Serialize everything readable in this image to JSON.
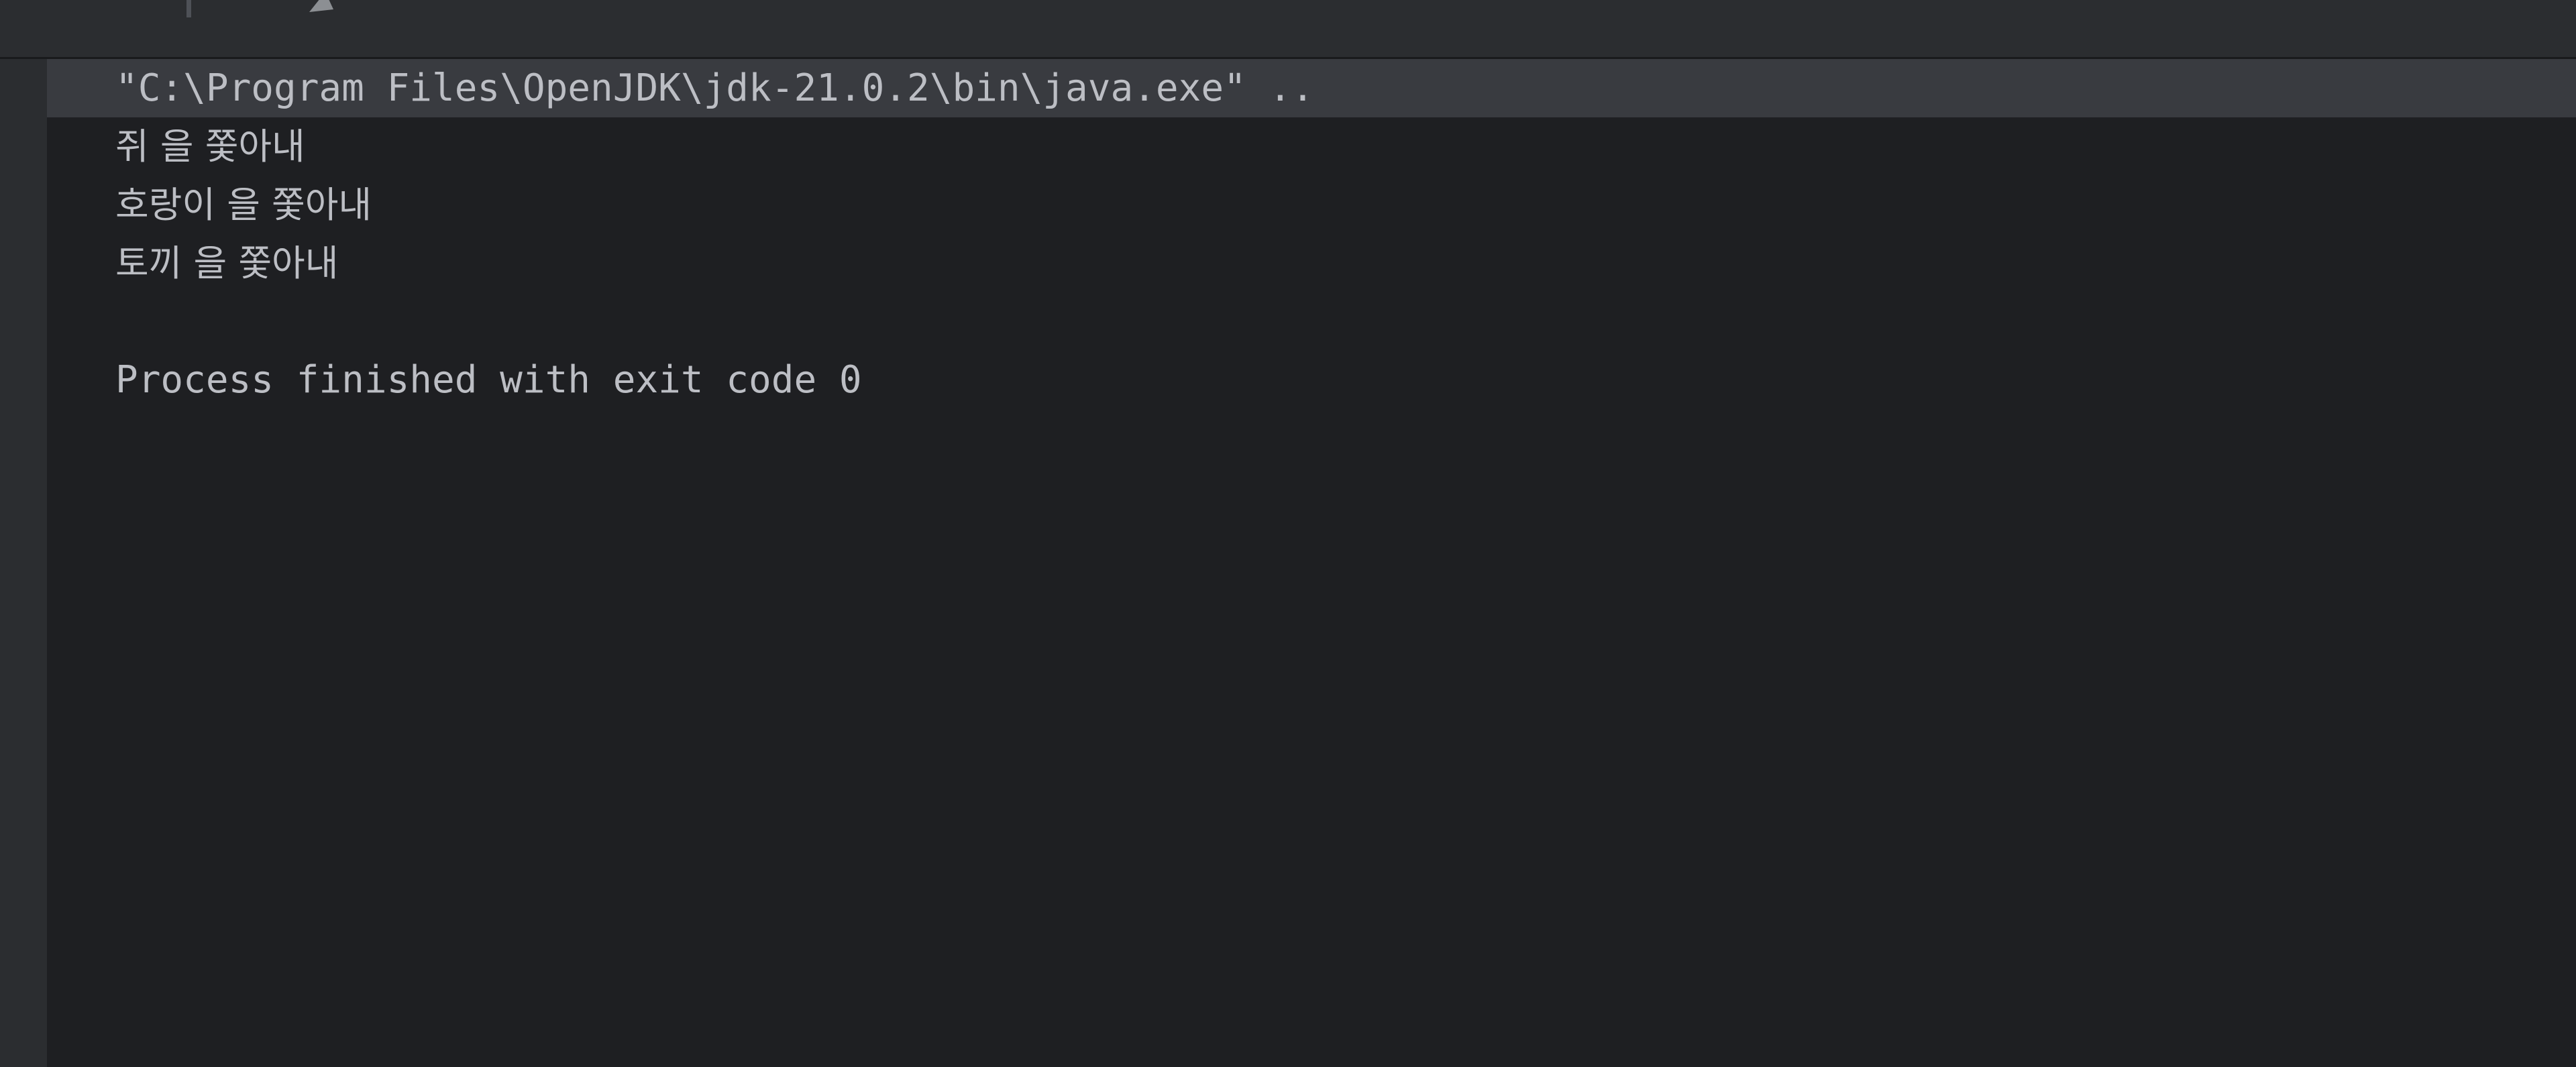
{
  "app": {
    "theme": "IntelliJ Darcula",
    "colors": {
      "toolbar_bg": "#2B2D30",
      "console_bg": "#1E1F22",
      "sidebar_bg": "#2B2D30",
      "highlight_bg": "#393B40",
      "text_fg": "#BCBEC4"
    }
  },
  "toolbar": {
    "caret_name": "text-caret",
    "glyph_name": "partial-toolbar-glyph"
  },
  "console": {
    "title": "Run Console Output",
    "lines": [
      {
        "id": "command-line",
        "text": "\"C:\\Program Files\\OpenJDK\\jdk-21.0.2\\bin\\java.exe\" ..",
        "highlighted": true,
        "korean": false
      },
      {
        "id": "output-line-1",
        "text": "쥐 을 쫓아내",
        "highlighted": false,
        "korean": true
      },
      {
        "id": "output-line-2",
        "text": "호랑이 을 쫓아내",
        "highlighted": false,
        "korean": true
      },
      {
        "id": "output-line-3",
        "text": "토끼 을 쫓아내",
        "highlighted": false,
        "korean": true
      },
      {
        "id": "blank-line",
        "text": " ",
        "highlighted": false,
        "korean": false
      },
      {
        "id": "process-exit-line",
        "text": "Process finished with exit code 0",
        "highlighted": false,
        "korean": false
      }
    ]
  }
}
